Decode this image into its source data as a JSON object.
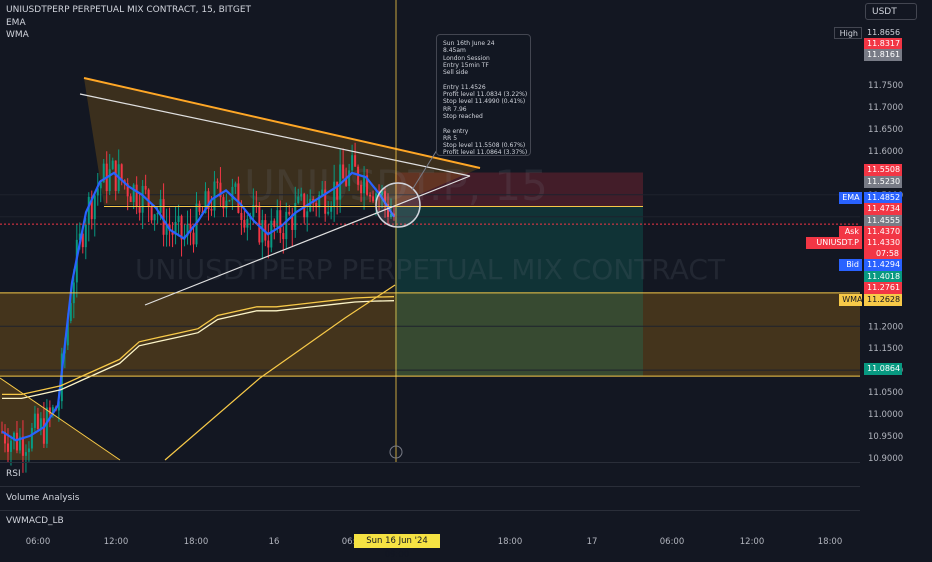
{
  "header": {
    "title": "UNIUSDTPERP PERPETUAL MIX CONTRACT, 15, BITGET",
    "indicators": [
      "EMA",
      "WMA"
    ]
  },
  "currency_button": "USDT",
  "watermark": {
    "symbol": "UNIUSDT.P, 15",
    "name": "UNIUSDTPERP PERPETUAL MIX CONTRACT"
  },
  "tooltip": {
    "lines": [
      "Sun 16th June 24",
      "8.45am",
      "London Session",
      "Entry 15min TF",
      "Sell side",
      "",
      "Entry 11.4526",
      "Profit level 11.0834 (3.22%)",
      "Stop level 11.4990 (0.41%)",
      "RR 7.96",
      "Stop reached",
      "",
      "Re entry",
      "RR 5",
      "Stop level 11.5508 (0.67%)",
      "Profit level 11.0864 (3.37%)"
    ]
  },
  "panes": [
    "RSI",
    "Volume Analysis",
    "VWMACD_LB"
  ],
  "crosshair_label": "Sun 16 Jun '24   09:00",
  "price_tags": [
    {
      "label": "High",
      "value": "11.8656",
      "bg": "#131722",
      "fg": "#d1d4dc",
      "border": "#434651"
    },
    {
      "label": "",
      "value": "11.8317",
      "bg": "#f23645",
      "fg": "#ffffff"
    },
    {
      "label": "",
      "value": "11.8161",
      "bg": "#787b86",
      "fg": "#ffffff"
    },
    {
      "label": "",
      "value": "11.5508",
      "bg": "#f23645",
      "fg": "#ffffff"
    },
    {
      "label": "",
      "value": "11.5230",
      "bg": "#787b86",
      "fg": "#ffffff"
    },
    {
      "label": "EMA",
      "value": "11.4852",
      "bg": "#2962ff",
      "fg": "#ffffff"
    },
    {
      "label": "",
      "value": "11.4734",
      "bg": "#f23645",
      "fg": "#ffffff"
    },
    {
      "label": "",
      "value": "11.4555",
      "bg": "#787b86",
      "fg": "#ffffff"
    },
    {
      "label": "Ask",
      "value": "11.4370",
      "bg": "#f23645",
      "fg": "#ffffff"
    },
    {
      "label": "UNIUSDT.P",
      "value": "11.4330",
      "bg": "#f23645",
      "fg": "#ffffff"
    },
    {
      "label": "",
      "value": "07:58",
      "bg": "#f23645",
      "fg": "#ffffff"
    },
    {
      "label": "Bid",
      "value": "11.4294",
      "bg": "#2962ff",
      "fg": "#ffffff"
    },
    {
      "label": "",
      "value": "11.4018",
      "bg": "#089981",
      "fg": "#ffffff"
    },
    {
      "label": "",
      "value": "11.2761",
      "bg": "#f23645",
      "fg": "#ffffff"
    },
    {
      "label": "WMA",
      "value": "11.2628",
      "bg": "#f7c948",
      "fg": "#131722"
    },
    {
      "label": "",
      "value": "11.0864",
      "bg": "#089981",
      "fg": "#ffffff"
    }
  ],
  "chart_data": {
    "type": "line",
    "title": "UNIUSDTPERP PERPETUAL MIX CONTRACT, 15, BITGET",
    "y_axis": {
      "ticks": [
        "11.7500",
        "11.7000",
        "11.6500",
        "11.6000",
        "11.5000",
        "11.2000",
        "11.1500",
        "11.1000",
        "11.0500",
        "11.0000",
        "10.9500",
        "10.9000"
      ],
      "range": [
        10.895,
        11.885
      ]
    },
    "x_axis": {
      "ticks": [
        "06:00",
        "12:00",
        "18:00",
        "16",
        "06:00",
        "18:00",
        "17",
        "06:00",
        "12:00",
        "18:00"
      ]
    },
    "price_levels": {
      "high": 11.8656,
      "entry": 11.4734,
      "stop": 11.5508,
      "target": 11.0864,
      "zone_top": 11.2761,
      "zone_bottom": 11.0864,
      "ema": 11.4852,
      "wma": 11.2628,
      "last": 11.433
    },
    "series": [
      {
        "name": "EMA",
        "color": "#2962ff",
        "values": [
          10.96,
          10.94,
          10.95,
          10.97,
          11.02,
          11.3,
          11.46,
          11.53,
          11.55,
          11.52,
          11.5,
          11.47,
          11.42,
          11.4,
          11.44,
          11.49,
          11.51,
          11.48,
          11.44,
          11.41,
          11.43,
          11.46,
          11.48,
          11.5,
          11.52,
          11.55,
          11.54,
          11.5,
          11.45
        ]
      },
      {
        "name": "WMA",
        "color": "#f7c948",
        "values": [
          11.04,
          11.04,
          11.05,
          11.06,
          11.08,
          11.1,
          11.12,
          11.16,
          11.17,
          11.18,
          11.19,
          11.22,
          11.23,
          11.24,
          11.24,
          11.245,
          11.25,
          11.255,
          11.26,
          11.262,
          11.263
        ]
      }
    ]
  }
}
